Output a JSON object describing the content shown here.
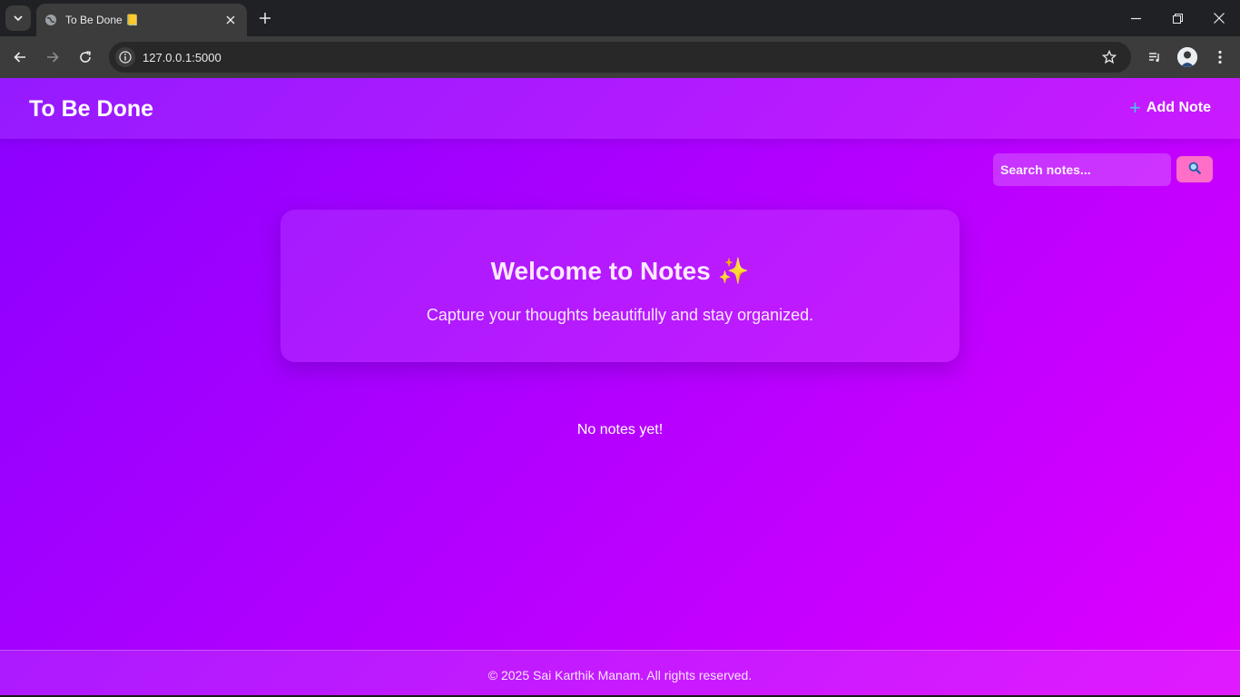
{
  "browser": {
    "tab_title": "To Be Done 📒",
    "url": "127.0.0.1:5000",
    "icons": [
      "tab-search-icon",
      "globe-icon",
      "close-icon",
      "plus-icon",
      "minimize-icon",
      "restore-icon",
      "window-close-icon",
      "back-icon",
      "forward-icon",
      "reload-icon",
      "info-icon",
      "star-icon",
      "media-icon",
      "avatar",
      "more-icon"
    ]
  },
  "header": {
    "brand": "To Be Done",
    "add_note_label": "Add Note"
  },
  "search": {
    "placeholder": "Search notes...",
    "button_icon": "🔍"
  },
  "welcome": {
    "title": "Welcome to Notes ✨",
    "subtitle": "Capture your thoughts beautifully and stay organized."
  },
  "notes": {
    "empty_message": "No notes yet!"
  },
  "footer": {
    "text": "© 2025 Sai Karthik Manam. All rights reserved."
  },
  "colors": {
    "gradient_start": "#8a00ff",
    "gradient_end": "#de00ff",
    "search_button": "#ff6ec7",
    "plus_accent": "#4bc0f0"
  }
}
